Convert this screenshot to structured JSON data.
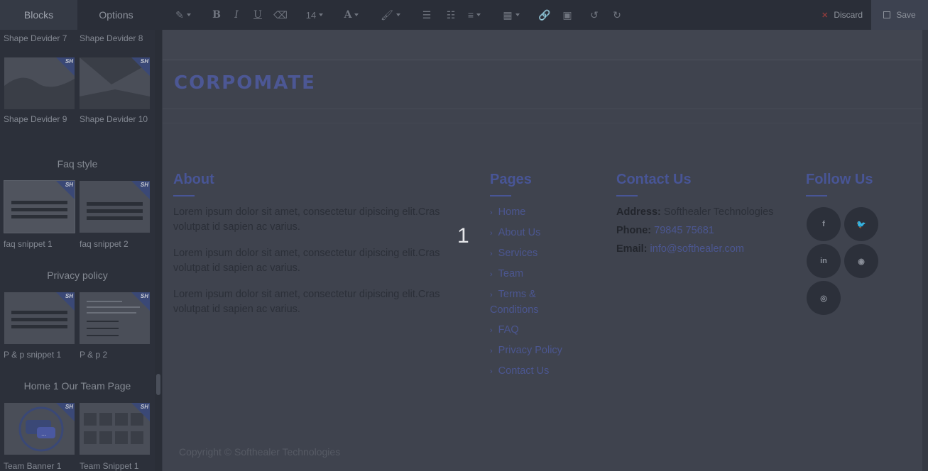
{
  "sidebar": {
    "tabs": [
      {
        "label": "Blocks"
      },
      {
        "label": "Options"
      }
    ],
    "snippets": [
      {
        "label": "Shape Devider 7"
      },
      {
        "label": "Shape Devider 8"
      },
      {
        "label": "Shape Devider 9"
      },
      {
        "label": "Shape Devider 10"
      },
      {
        "label": "faq snippet 1"
      },
      {
        "label": "faq snippet 2"
      },
      {
        "label": "P & p snippet 1"
      },
      {
        "label": "P & p 2"
      },
      {
        "label": "Team Banner 1"
      },
      {
        "label": "Team Snippet 1"
      }
    ],
    "sections": [
      {
        "title": "Faq style"
      },
      {
        "title": "Privacy policy"
      },
      {
        "title": "Home 1 Our Team Page"
      }
    ],
    "badge_text": "SH"
  },
  "toolbar": {
    "font_size": "14",
    "discard_label": "Discard",
    "save_label": "Save"
  },
  "page": {
    "logo": "CORPOMATE",
    "about": {
      "title": "About",
      "paragraphs": [
        "Lorem ipsum dolor sit amet, consectetur dipiscing elit.Cras volutpat id sapien ac varius.",
        "Lorem ipsum dolor sit amet, consectetur dipiscing elit.Cras volutpat id sapien ac varius.",
        "Lorem ipsum dolor sit amet, consectetur dipiscing elit.Cras volutpat id sapien ac varius."
      ]
    },
    "pages": {
      "title": "Pages",
      "links": [
        "Home",
        "About Us",
        "Services",
        "Team",
        "Terms & Conditions",
        "FAQ",
        "Privacy Policy",
        "Contact Us"
      ]
    },
    "contact": {
      "title": "Contact Us",
      "address_label": "Address:",
      "address": "Softhealer Technologies",
      "phone_label": "Phone:",
      "phone": "79845 75681",
      "email_label": "Email:",
      "email": "info@softhealer.com"
    },
    "follow": {
      "title": "Follow Us",
      "icons": [
        "facebook-icon",
        "twitter-icon",
        "linkedin-icon",
        "github-icon",
        "instagram-icon"
      ]
    },
    "copyright": "Copyright © Softhealer Technologies",
    "overlay_number": "1"
  },
  "colors": {
    "accent": "#485596",
    "badge": "#3a4876",
    "discard": "#8b3b3b"
  }
}
